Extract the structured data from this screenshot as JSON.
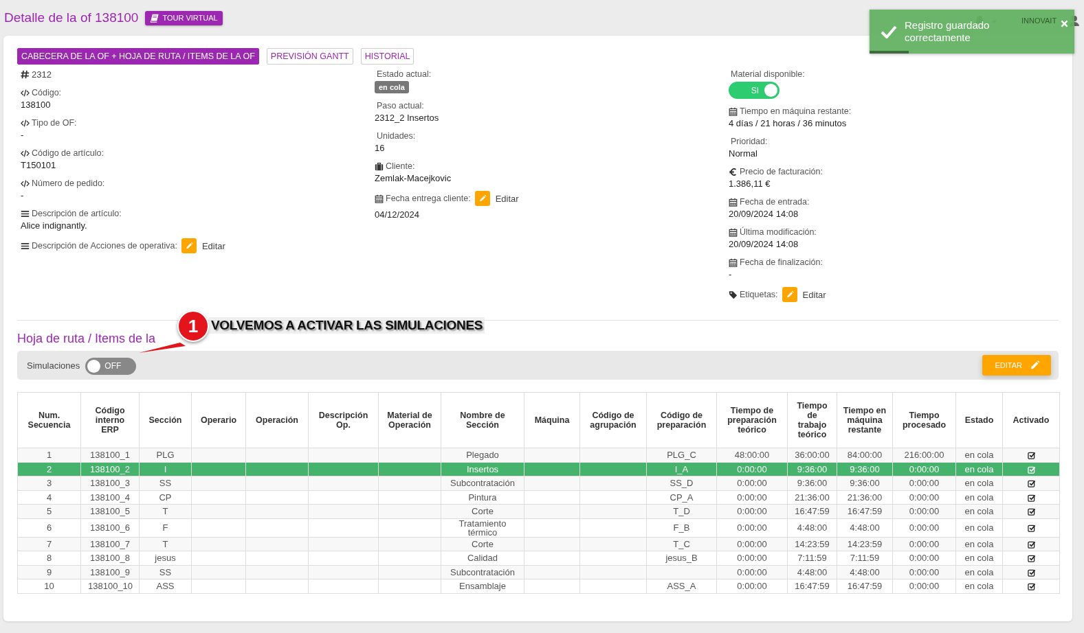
{
  "title": "Detalle de la of 138100",
  "tour_button": "TOUR VIRTUAL",
  "header": {
    "user": "INNOVAIT"
  },
  "toast": {
    "message": "Registro guardado correctamente",
    "level": 0.19
  },
  "tabs": [
    {
      "label": "CABECERA DE LA OF + HOJA DE RUTA / ITEMS DE LA OF",
      "selected": true
    },
    {
      "label": "PREVISIÓN GANTT",
      "selected": false
    },
    {
      "label": "HISTORIAL",
      "selected": false
    }
  ],
  "field_columns": [
    [
      {
        "kind": "id",
        "value": "2312"
      },
      {
        "kind": "code",
        "label": "Código:",
        "value": "138100"
      },
      {
        "kind": "code",
        "label": "Tipo de OF:",
        "value": "-"
      },
      {
        "kind": "code",
        "label": "Código de artículo:",
        "value": "T150101"
      },
      {
        "kind": "code",
        "label": "Número de pedido:",
        "value": "-"
      },
      {
        "kind": "text",
        "label": "Descripción de artículo:",
        "value": "Alice indignantly."
      },
      {
        "kind": "text",
        "label": "Descripción de Acciones de operativa:",
        "action": "Editar"
      }
    ],
    [
      {
        "kind": "status",
        "label": "Estado actual:",
        "value": "en cola"
      },
      {
        "kind": "plain",
        "label": "Paso actual:",
        "value": "2312_2 Insertos"
      },
      {
        "kind": "plain",
        "label": "Unidades:",
        "value": "16"
      },
      {
        "kind": "client",
        "label": "Cliente:",
        "value": "Zemlak-Macejkovic"
      },
      {
        "kind": "date",
        "label": "Fecha entrega cliente:",
        "action": "Editar",
        "value": "04/12/2024"
      }
    ],
    [
      {
        "kind": "switch",
        "label": "Material disponible:",
        "value": "SI",
        "on": true
      },
      {
        "kind": "date",
        "label": "Tiempo en máquina restante:",
        "value": "4 días / 21 horas / 36 minutos"
      },
      {
        "kind": "plain",
        "label": "Prioridad:",
        "value": "Normal"
      },
      {
        "kind": "price",
        "label": "Precio de facturación:",
        "value": "1.386,11 €"
      },
      {
        "kind": "date",
        "label": "Fecha de entrada:",
        "value": "20/09/2024 14:08"
      },
      {
        "kind": "date",
        "label": "Última modificación:",
        "value": "20/09/2024 14:08"
      },
      {
        "kind": "date",
        "label": "Fecha de finalización:",
        "value": "-"
      },
      {
        "kind": "tag",
        "label": "Etiquetas:",
        "action": "Editar"
      }
    ]
  ],
  "section_title": "Hoja de ruta / Items de la",
  "annotation": {
    "number": "1",
    "text": "VOLVEMOS A ACTIVAR LAS SIMULACIONES"
  },
  "simulations": {
    "label": "Simulaciones",
    "value": "OFF",
    "on": false
  },
  "edit_button": "EDITAR",
  "table": {
    "columns": [
      "Num. Secuencia",
      "Código interno ERP",
      "Sección",
      "Operario",
      "Operación",
      "Descripción Op.",
      "Material de Operación",
      "Nombre de Sección",
      "Máquina",
      "Código de agrupación",
      "Código de preparación",
      "Tiempo de preparación teórico",
      "Tiempo de trabajo teórico",
      "Tiempo en máquina restante",
      "Tiempo procesado",
      "Estado",
      "Activado"
    ],
    "rows": [
      {
        "cells": [
          "1",
          "138100_1",
          "PLG",
          "",
          "",
          "",
          "",
          "Plegado",
          "",
          "",
          "PLG_C",
          "48:00:00",
          "36:00:00",
          "84:00:00",
          "216:00:00",
          "en cola"
        ],
        "activated": true,
        "selected": false
      },
      {
        "cells": [
          "2",
          "138100_2",
          "I",
          "",
          "",
          "",
          "",
          "Insertos",
          "",
          "",
          "I_A",
          "0:00:00",
          "9:36:00",
          "9:36:00",
          "0:00:00",
          "en cola"
        ],
        "activated": true,
        "selected": true
      },
      {
        "cells": [
          "3",
          "138100_3",
          "SS",
          "",
          "",
          "",
          "",
          "Subcontratación",
          "",
          "",
          "SS_D",
          "0:00:00",
          "9:36:00",
          "9:36:00",
          "0:00:00",
          "en cola"
        ],
        "activated": true,
        "selected": false
      },
      {
        "cells": [
          "4",
          "138100_4",
          "CP",
          "",
          "",
          "",
          "",
          "Pintura",
          "",
          "",
          "CP_A",
          "0:00:00",
          "21:36:00",
          "21:36:00",
          "0:00:00",
          "en cola"
        ],
        "activated": true,
        "selected": false
      },
      {
        "cells": [
          "5",
          "138100_5",
          "T",
          "",
          "",
          "",
          "",
          "Corte",
          "",
          "",
          "T_D",
          "0:00:00",
          "16:47:59",
          "16:47:59",
          "0:00:00",
          "en cola"
        ],
        "activated": true,
        "selected": false
      },
      {
        "cells": [
          "6",
          "138100_6",
          "F",
          "",
          "",
          "",
          "",
          "Tratamiento térmico",
          "",
          "",
          "F_B",
          "0:00:00",
          "4:48:00",
          "4:48:00",
          "0:00:00",
          "en cola"
        ],
        "activated": true,
        "selected": false
      },
      {
        "cells": [
          "7",
          "138100_7",
          "T",
          "",
          "",
          "",
          "",
          "Corte",
          "",
          "",
          "T_C",
          "0:00:00",
          "14:23:59",
          "14:23:59",
          "0:00:00",
          "en cola"
        ],
        "activated": true,
        "selected": false
      },
      {
        "cells": [
          "8",
          "138100_8",
          "jesus",
          "",
          "",
          "",
          "",
          "Calidad",
          "",
          "",
          "jesus_B",
          "0:00:00",
          "7:11:59",
          "7:11:59",
          "0:00:00",
          "en cola"
        ],
        "activated": true,
        "selected": false
      },
      {
        "cells": [
          "9",
          "138100_9",
          "SS",
          "",
          "",
          "",
          "",
          "Subcontratación",
          "",
          "",
          "",
          "0:00:00",
          "4:48:00",
          "4:48:00",
          "0:00:00",
          "en cola"
        ],
        "activated": true,
        "selected": false
      },
      {
        "cells": [
          "10",
          "138100_10",
          "ASS",
          "",
          "",
          "",
          "",
          "Ensamblaje",
          "",
          "",
          "ASS_A",
          "0:00:00",
          "16:47:59",
          "16:47:59",
          "0:00:00",
          "en cola"
        ],
        "activated": true,
        "selected": false
      }
    ]
  }
}
